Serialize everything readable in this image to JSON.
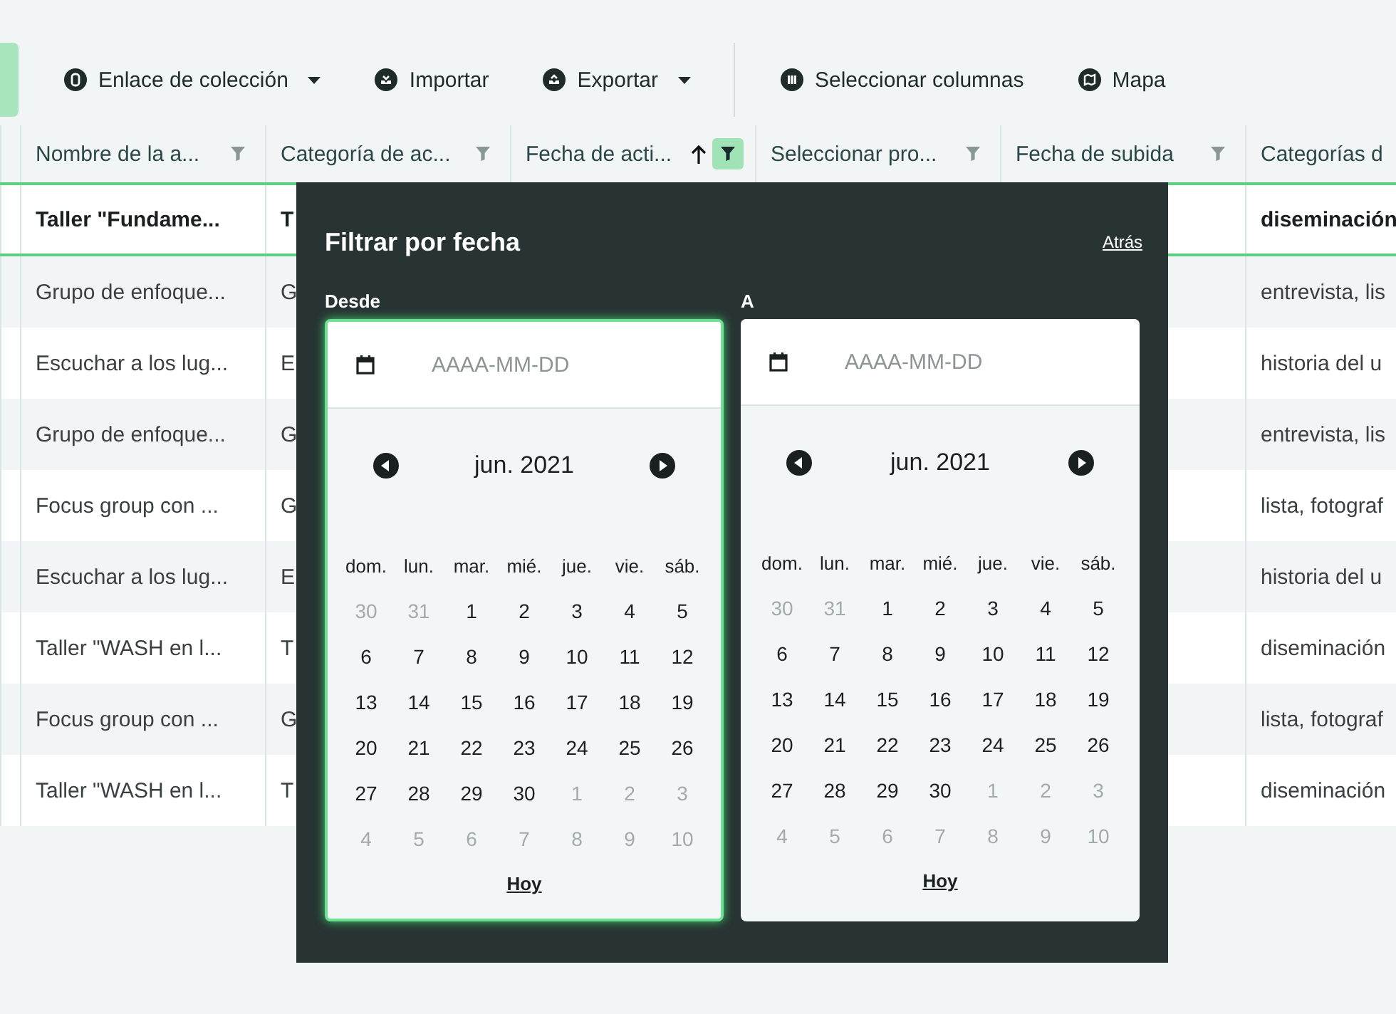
{
  "toolbar": {
    "buttons": [
      {
        "label": "Enlace de colección",
        "dropdown": true
      },
      {
        "label": "Importar",
        "dropdown": false
      },
      {
        "label": "Exportar",
        "dropdown": true
      },
      {
        "label": "Seleccionar columnas",
        "dropdown": false
      },
      {
        "label": "Mapa",
        "dropdown": false
      }
    ]
  },
  "table": {
    "columns": [
      {
        "label": "Nombre de la a...",
        "sorted": false,
        "filter_active": false
      },
      {
        "label": "Categoría de ac...",
        "sorted": false,
        "filter_active": false
      },
      {
        "label": "Fecha de acti...",
        "sorted": true,
        "filter_active": true
      },
      {
        "label": "Seleccionar pro...",
        "sorted": false,
        "filter_active": false
      },
      {
        "label": "Fecha de subida",
        "sorted": false,
        "filter_active": false
      },
      {
        "label": "Categorías d",
        "sorted": false
      }
    ],
    "rows": [
      {
        "nombre": "Taller \"Fundame...",
        "categoria": "T",
        "categorias": "diseminación",
        "highlighted": true
      },
      {
        "nombre": "Grupo de enfoque...",
        "categoria": "G",
        "categorias": "entrevista, lis",
        "highlighted": false
      },
      {
        "nombre": "Escuchar a los lug...",
        "categoria": "E",
        "categorias": "historia del u",
        "highlighted": false
      },
      {
        "nombre": "Grupo de enfoque...",
        "categoria": "G",
        "categorias": "entrevista, lis",
        "highlighted": false
      },
      {
        "nombre": "Focus group con ...",
        "categoria": "G",
        "categorias": "lista, fotograf",
        "highlighted": false
      },
      {
        "nombre": "Escuchar a los lug...",
        "categoria": "E",
        "categorias": "historia del u",
        "highlighted": false
      },
      {
        "nombre": "Taller \"WASH en l...",
        "categoria": "T",
        "categorias": "diseminación",
        "highlighted": false
      },
      {
        "nombre": "Focus group con ...",
        "categoria": "G",
        "categorias": "lista, fotograf",
        "highlighted": false
      },
      {
        "nombre": "Taller \"WASH en l...",
        "categoria": "T",
        "categorias": "diseminación",
        "highlighted": false
      }
    ]
  },
  "filter_popup": {
    "title": "Filtrar por fecha",
    "back_link": "Atrás",
    "calendars": [
      {
        "label": "Desde",
        "placeholder": "AAAA-MM-DD",
        "focused": true,
        "month": "jun. 2021",
        "today_link": "Hoy",
        "weekdays": [
          "dom.",
          "lun.",
          "mar.",
          "mié.",
          "jue.",
          "vie.",
          "sáb."
        ],
        "weeks": [
          [
            {
              "day": "30",
              "outside": true
            },
            {
              "day": "31",
              "outside": true
            },
            {
              "day": "1",
              "outside": false
            },
            {
              "day": "2",
              "outside": false
            },
            {
              "day": "3",
              "outside": false
            },
            {
              "day": "4",
              "outside": false
            },
            {
              "day": "5",
              "outside": false
            }
          ],
          [
            {
              "day": "6",
              "outside": false
            },
            {
              "day": "7",
              "outside": false
            },
            {
              "day": "8",
              "outside": false
            },
            {
              "day": "9",
              "outside": false
            },
            {
              "day": "10",
              "outside": false
            },
            {
              "day": "11",
              "outside": false
            },
            {
              "day": "12",
              "outside": false
            }
          ],
          [
            {
              "day": "13",
              "outside": false
            },
            {
              "day": "14",
              "outside": false
            },
            {
              "day": "15",
              "outside": false
            },
            {
              "day": "16",
              "outside": false
            },
            {
              "day": "17",
              "outside": false
            },
            {
              "day": "18",
              "outside": false
            },
            {
              "day": "19",
              "outside": false
            }
          ],
          [
            {
              "day": "20",
              "outside": false
            },
            {
              "day": "21",
              "outside": false
            },
            {
              "day": "22",
              "outside": false
            },
            {
              "day": "23",
              "outside": false
            },
            {
              "day": "24",
              "outside": false
            },
            {
              "day": "25",
              "outside": false
            },
            {
              "day": "26",
              "outside": false
            }
          ],
          [
            {
              "day": "27",
              "outside": false
            },
            {
              "day": "28",
              "outside": false
            },
            {
              "day": "29",
              "outside": false
            },
            {
              "day": "30",
              "outside": false
            },
            {
              "day": "1",
              "outside": true
            },
            {
              "day": "2",
              "outside": true
            },
            {
              "day": "3",
              "outside": true
            }
          ],
          [
            {
              "day": "4",
              "outside": true
            },
            {
              "day": "5",
              "outside": true
            },
            {
              "day": "6",
              "outside": true
            },
            {
              "day": "7",
              "outside": true
            },
            {
              "day": "8",
              "outside": true
            },
            {
              "day": "9",
              "outside": true
            },
            {
              "day": "10",
              "outside": true
            }
          ]
        ]
      },
      {
        "label": "A",
        "placeholder": "AAAA-MM-DD",
        "focused": false,
        "month": "jun. 2021",
        "today_link": "Hoy",
        "weekdays": [
          "dom.",
          "lun.",
          "mar.",
          "mié.",
          "jue.",
          "vie.",
          "sáb."
        ],
        "weeks": [
          [
            {
              "day": "30",
              "outside": true
            },
            {
              "day": "31",
              "outside": true
            },
            {
              "day": "1",
              "outside": false
            },
            {
              "day": "2",
              "outside": false
            },
            {
              "day": "3",
              "outside": false
            },
            {
              "day": "4",
              "outside": false
            },
            {
              "day": "5",
              "outside": false
            }
          ],
          [
            {
              "day": "6",
              "outside": false
            },
            {
              "day": "7",
              "outside": false
            },
            {
              "day": "8",
              "outside": false
            },
            {
              "day": "9",
              "outside": false
            },
            {
              "day": "10",
              "outside": false
            },
            {
              "day": "11",
              "outside": false
            },
            {
              "day": "12",
              "outside": false
            }
          ],
          [
            {
              "day": "13",
              "outside": false
            },
            {
              "day": "14",
              "outside": false
            },
            {
              "day": "15",
              "outside": false
            },
            {
              "day": "16",
              "outside": false
            },
            {
              "day": "17",
              "outside": false
            },
            {
              "day": "18",
              "outside": false
            },
            {
              "day": "19",
              "outside": false
            }
          ],
          [
            {
              "day": "20",
              "outside": false
            },
            {
              "day": "21",
              "outside": false
            },
            {
              "day": "22",
              "outside": false
            },
            {
              "day": "23",
              "outside": false
            },
            {
              "day": "24",
              "outside": false
            },
            {
              "day": "25",
              "outside": false
            },
            {
              "day": "26",
              "outside": false
            }
          ],
          [
            {
              "day": "27",
              "outside": false
            },
            {
              "day": "28",
              "outside": false
            },
            {
              "day": "29",
              "outside": false
            },
            {
              "day": "30",
              "outside": false
            },
            {
              "day": "1",
              "outside": true
            },
            {
              "day": "2",
              "outside": true
            },
            {
              "day": "3",
              "outside": true
            }
          ],
          [
            {
              "day": "4",
              "outside": true
            },
            {
              "day": "5",
              "outside": true
            },
            {
              "day": "6",
              "outside": true
            },
            {
              "day": "7",
              "outside": true
            },
            {
              "day": "8",
              "outside": true
            },
            {
              "day": "9",
              "outside": true
            },
            {
              "day": "10",
              "outside": true
            }
          ]
        ]
      }
    ]
  }
}
